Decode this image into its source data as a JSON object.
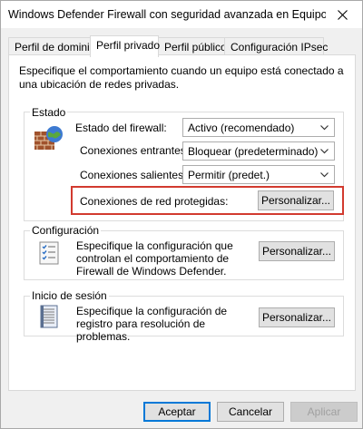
{
  "window": {
    "title": "Windows Defender Firewall con seguridad avanzada en Equipo loc..."
  },
  "tabs": [
    {
      "label": "Perfil de dominio"
    },
    {
      "label": "Perfil privado"
    },
    {
      "label": "Perfil público"
    },
    {
      "label": "Configuración IPsec"
    }
  ],
  "description": "Especifique el comportamiento cuando un equipo está conectado a una ubicación de redes privadas.",
  "state": {
    "group_label": "Estado",
    "firewall_label": "Estado del firewall:",
    "firewall_value": "Activo (recomendado)",
    "inbound_label": "Conexiones entrantes:",
    "inbound_value": "Bloquear (predeterminado)",
    "outbound_label": "Conexiones salientes:",
    "outbound_value": "Permitir (predet.)",
    "protected_label": "Conexiones de red protegidas:",
    "protected_button": "Personalizar..."
  },
  "settings": {
    "group_label": "Configuración",
    "text": "Especifique la configuración que controlan el comportamiento de Firewall de Windows Defender.",
    "button": "Personalizar..."
  },
  "logging": {
    "group_label": "Inicio de sesión",
    "text": "Especifique la configuración de registro para resolución de problemas.",
    "button": "Personalizar..."
  },
  "footer": {
    "accept": "Aceptar",
    "cancel": "Cancelar",
    "apply": "Aplicar"
  },
  "colors": {
    "highlight": "#d23a2f",
    "focus": "#0078d7"
  }
}
